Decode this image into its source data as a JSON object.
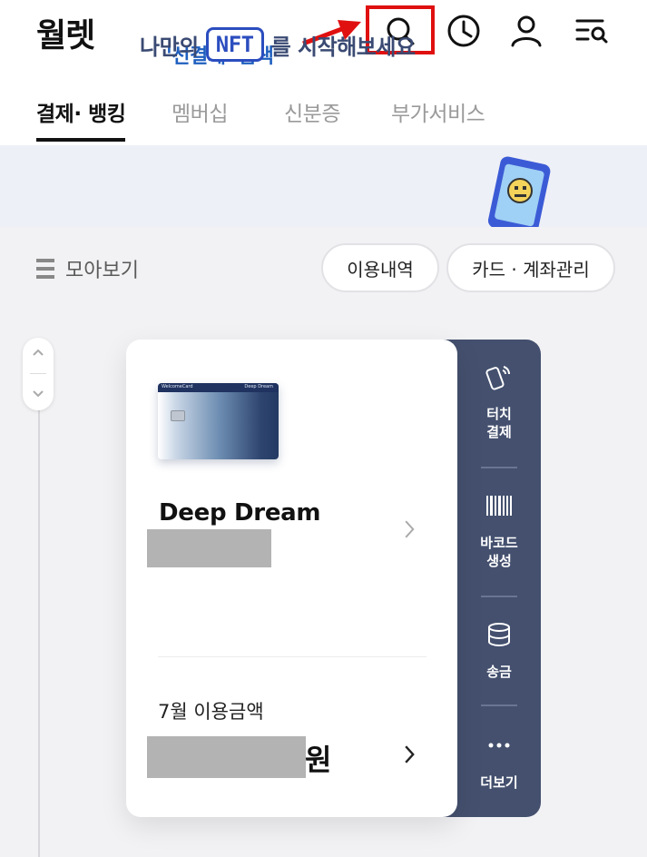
{
  "header": {
    "title": "월렛",
    "icons": [
      "search-icon",
      "history-icon",
      "profile-icon",
      "menu-search-icon"
    ]
  },
  "annotation": {
    "text": "'선결제' 검색",
    "highlight_color": "#e01010",
    "text_color": "#1f5fbf"
  },
  "tabs": [
    {
      "label": "결제· 뱅킹",
      "active": true
    },
    {
      "label": "멤버십",
      "active": false
    },
    {
      "label": "신분증",
      "active": false
    },
    {
      "label": "부가서비스",
      "active": false
    }
  ],
  "banner": {
    "prefix": "나만의",
    "badge": "NFT",
    "suffix": "를 시작해보세요"
  },
  "toolbar": {
    "collect_label": "모아보기",
    "history_button": "이용내역",
    "manage_button": "카드 · 계좌관리"
  },
  "card": {
    "name": "Deep Dream",
    "image_brand": "WelcomeCard",
    "image_name": "Deep Dream",
    "usage_label": "7월 이용금액",
    "usage_unit": "원"
  },
  "side_panel": {
    "touch_label_1": "터치",
    "touch_label_2": "결제",
    "barcode_label_1": "바코드",
    "barcode_label_2": "생성",
    "transfer_label": "송금",
    "more_label": "더보기",
    "bg_color": "#44506e"
  }
}
